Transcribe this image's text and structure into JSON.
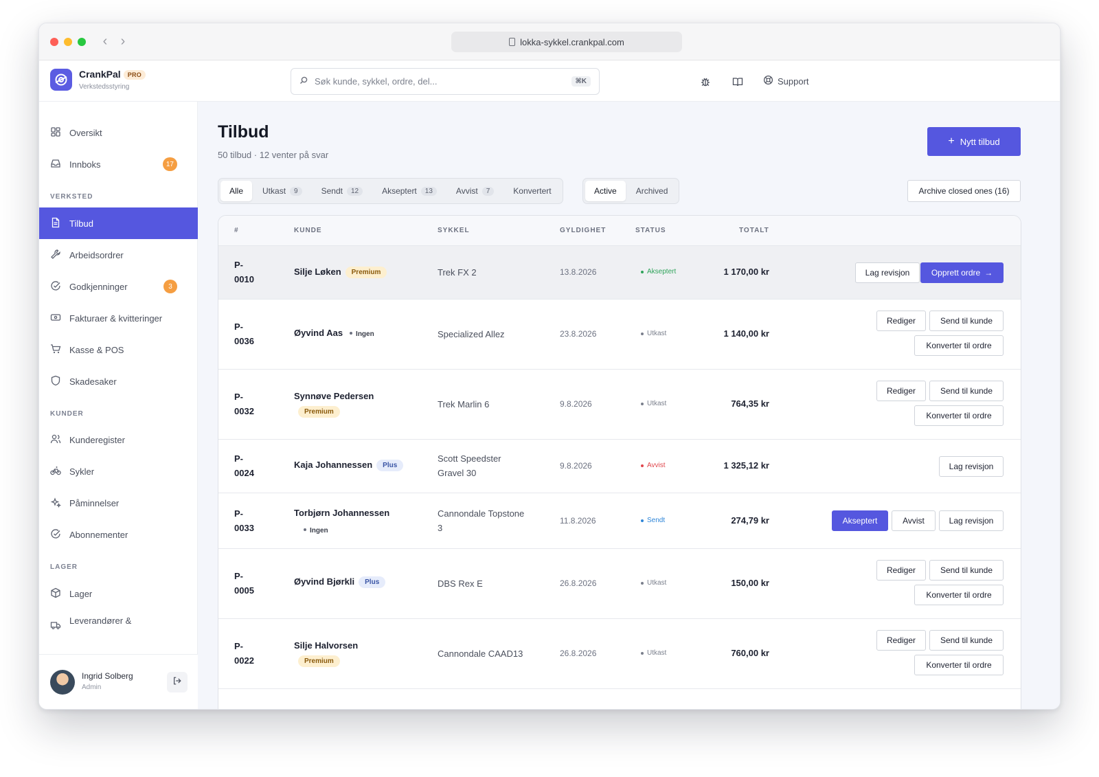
{
  "browser": {
    "url": "lokka-sykkel.crankpal.com",
    "back_icon": "chevron-left-icon",
    "forward_icon": "chevron-right-icon"
  },
  "brand": {
    "name": "CrankPal",
    "badge": "PRO",
    "subtitle": "Verkstedsstyring",
    "accent": "#5557df"
  },
  "search": {
    "placeholder": "Søk kunde, sykkel, ordre, del...",
    "shortcut": "⌘K"
  },
  "header": {
    "support_label": "Support"
  },
  "sidebar": {
    "items_top": [
      {
        "label": "Oversikt",
        "icon": "grid-icon"
      },
      {
        "label": "Innboks",
        "icon": "inbox-icon",
        "badge": "17"
      }
    ],
    "section_verksted": "VERKSTED",
    "items_verksted": [
      {
        "label": "Tilbud",
        "icon": "document-icon",
        "active": true
      },
      {
        "label": "Arbeidsordrer",
        "icon": "wrench-icon"
      },
      {
        "label": "Godkjenninger",
        "icon": "check-circle-icon",
        "badge": "3"
      },
      {
        "label": "Fakturaer & kvitteringer",
        "icon": "receipt-icon"
      },
      {
        "label": "Kasse & POS",
        "icon": "cart-icon"
      },
      {
        "label": "Skadesaker",
        "icon": "shield-icon"
      }
    ],
    "section_kunder": "KUNDER",
    "items_kunder": [
      {
        "label": "Kunderegister",
        "icon": "users-icon"
      },
      {
        "label": "Sykler",
        "icon": "bike-icon"
      },
      {
        "label": "Påminnelser",
        "icon": "sparkle-icon"
      },
      {
        "label": "Abonnementer",
        "icon": "check-circle-icon"
      }
    ],
    "section_lager": "LAGER",
    "items_lager": [
      {
        "label": "Lager",
        "icon": "box-icon"
      },
      {
        "label": "Leverandører &",
        "icon": "truck-icon"
      }
    ],
    "user": {
      "name": "Ingrid Solberg",
      "role": "Admin"
    }
  },
  "page": {
    "title": "Tilbud",
    "subtitle": "50 tilbud · 12 venter på svar",
    "new_button": "Nytt tilbud",
    "archive_button": "Archive closed ones (16)"
  },
  "filter_tabs": [
    {
      "label": "Alle",
      "count": "",
      "active": true
    },
    {
      "label": "Utkast",
      "count": "9"
    },
    {
      "label": "Sendt",
      "count": "12"
    },
    {
      "label": "Akseptert",
      "count": "13"
    },
    {
      "label": "Avvist",
      "count": "7"
    },
    {
      "label": "Konvertert",
      "count": ""
    }
  ],
  "archive_tabs": [
    {
      "label": "Active",
      "active": true
    },
    {
      "label": "Archived"
    }
  ],
  "table": {
    "headers": {
      "id": "#",
      "kunde": "KUNDE",
      "sykkel": "SYKKEL",
      "gyldighet": "GYLDIGHET",
      "status": "STATUS",
      "totalt": "TOTALT"
    },
    "rows": [
      {
        "id_a": "P-",
        "id_b": "0010",
        "kunde": "Silje Løken",
        "tier": "Premium",
        "tier_type": "premium",
        "tier_inline": true,
        "sykkel_a": "Trek FX 2",
        "sykkel_b": "",
        "date": "13.8.2026",
        "status": "Akseptert",
        "status_color": "#2fa35a",
        "total": "1 170,00 kr",
        "actions": [
          "Lag revisjon",
          "Opprett ordre"
        ]
      },
      {
        "id_a": "P-",
        "id_b": "0036",
        "kunde": "Øyvind Aas",
        "tier": "Ingen",
        "tier_type": "none",
        "tier_inline": true,
        "sykkel_a": "Specialized Allez",
        "sykkel_b": "",
        "date": "23.8.2026",
        "status": "Utkast",
        "status_color": "#7a7f8c",
        "total": "1 140,00 kr",
        "actions": [
          "Rediger",
          "Send til kunde",
          "Konverter til ordre"
        ]
      },
      {
        "id_a": "P-",
        "id_b": "0032",
        "kunde": "Synnøve Pedersen",
        "tier": "Premium",
        "tier_type": "premium",
        "tier_inline": false,
        "sykkel_a": "Trek Marlin 6",
        "sykkel_b": "",
        "date": "9.8.2026",
        "status": "Utkast",
        "status_color": "#7a7f8c",
        "total": "764,35 kr",
        "actions": [
          "Rediger",
          "Send til kunde",
          "Konverter til ordre"
        ]
      },
      {
        "id_a": "P-",
        "id_b": "0024",
        "kunde": "Kaja Johannessen",
        "tier": "Plus",
        "tier_type": "plus",
        "tier_inline": true,
        "sykkel_a": "Scott Speedster",
        "sykkel_b": "Gravel 30",
        "date": "9.8.2026",
        "status": "Avvist",
        "status_color": "#e0464c",
        "total": "1 325,12 kr",
        "actions": [
          "Lag revisjon"
        ]
      },
      {
        "id_a": "P-",
        "id_b": "0033",
        "kunde": "Torbjørn Johannessen",
        "tier": "Ingen",
        "tier_type": "none",
        "tier_inline": false,
        "sykkel_a": "Cannondale Topstone",
        "sykkel_b": "3",
        "date": "11.8.2026",
        "status": "Sendt",
        "status_color": "#2f86d8",
        "total": "274,79 kr",
        "actions": [
          "Akseptert",
          "Avvist",
          "Lag revisjon"
        ]
      },
      {
        "id_a": "P-",
        "id_b": "0005",
        "kunde": "Øyvind Bjørkli",
        "tier": "Plus",
        "tier_type": "plus",
        "tier_inline": true,
        "sykkel_a": "DBS Rex E",
        "sykkel_b": "",
        "date": "26.8.2026",
        "status": "Utkast",
        "status_color": "#7a7f8c",
        "total": "150,00 kr",
        "actions": [
          "Rediger",
          "Send til kunde",
          "Konverter til ordre"
        ]
      },
      {
        "id_a": "P-",
        "id_b": "0022",
        "kunde": "Silje Halvorsen",
        "tier": "Premium",
        "tier_type": "premium",
        "tier_inline": false,
        "sykkel_a": "Cannondale CAAD13",
        "sykkel_b": "",
        "date": "26.8.2026",
        "status": "Utkast",
        "status_color": "#7a7f8c",
        "total": "760,00 kr",
        "actions": [
          "Rediger",
          "Send til kunde",
          "Konverter til ordre"
        ]
      }
    ]
  }
}
